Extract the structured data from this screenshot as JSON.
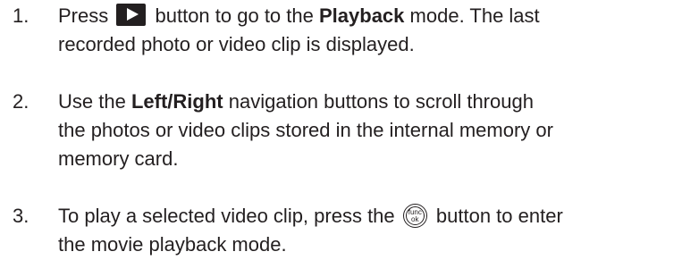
{
  "steps": [
    {
      "number": "1.",
      "line1_a": "Press",
      "line1_b": "button to go to the",
      "line1_bold": "Playback",
      "line1_c": "mode. The last",
      "line2": "recorded photo or video clip is displayed.",
      "icon": "play-button-icon"
    },
    {
      "number": "2.",
      "line1_a": "Use the",
      "line1_bold": "Left/Right",
      "line1_b": "navigation buttons to scroll through",
      "line2": "the photos or video clips stored in the internal memory or",
      "line3": "memory card."
    },
    {
      "number": "3.",
      "line1_a": "To play a selected video clip, press the",
      "line1_b": "button to enter",
      "line2": "the movie playback mode.",
      "icon": "func-ok-button-icon",
      "icon_text_top": "func",
      "icon_text_bottom": "ok"
    }
  ]
}
